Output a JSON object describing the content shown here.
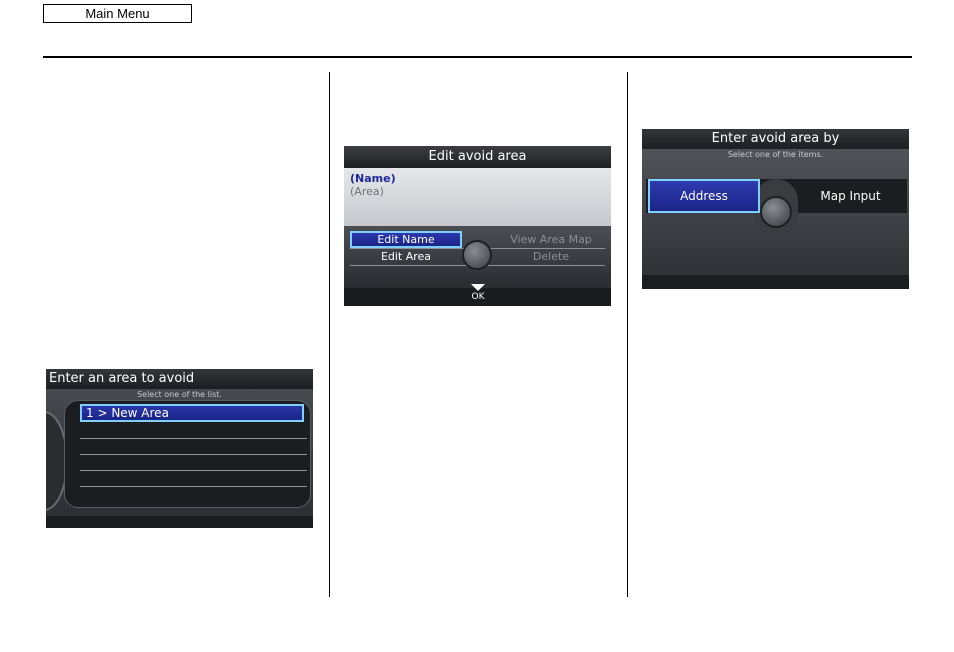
{
  "header": {
    "main_menu_label": "Main Menu"
  },
  "screen_area_list": {
    "title": "Enter an area to avoid",
    "subtitle": "Select one of the list.",
    "items": [
      {
        "label": "1 > New Area"
      }
    ]
  },
  "screen_edit_area": {
    "title": "Edit avoid area",
    "name_value": "(Name)",
    "area_value": "(Area)",
    "buttons": {
      "edit_name": "Edit Name",
      "edit_area": "Edit Area",
      "view_area_map": "View Area Map",
      "delete": "Delete"
    },
    "ok_label": "OK"
  },
  "screen_enter_by": {
    "title": "Enter avoid area by",
    "subtitle": "Select one of the items.",
    "buttons": {
      "address": "Address",
      "map_input": "Map Input"
    }
  },
  "colors": {
    "highlight": "#1b2486",
    "highlight_border": "#7fd0ff",
    "name_text": "#1c2a9a",
    "disabled_text": "#8c8f94"
  }
}
